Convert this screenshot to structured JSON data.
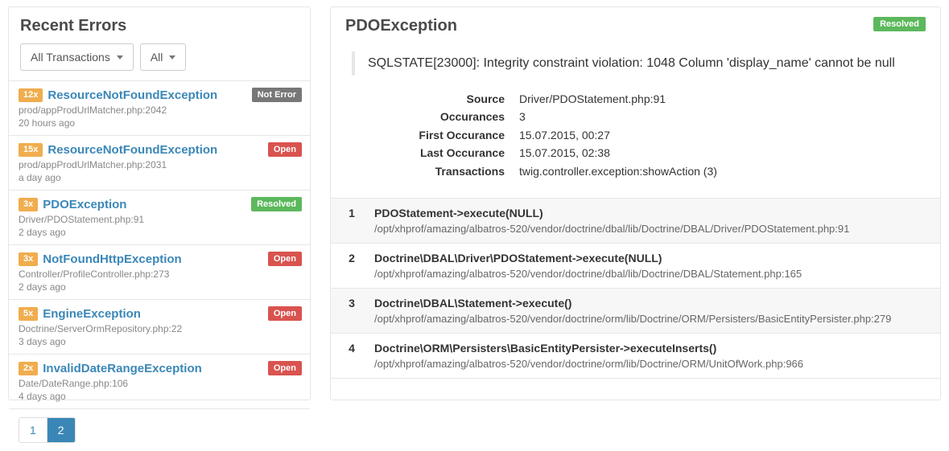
{
  "sidebar": {
    "title": "Recent Errors",
    "filters": {
      "transactions_label": "All Transactions",
      "types_label": "All"
    },
    "items": [
      {
        "count": "12x",
        "name": "ResourceNotFoundException",
        "file": "prod/appProdUrlMatcher.php:2042",
        "time": "20 hours ago",
        "status": "Not Error",
        "status_class": "status-noterror"
      },
      {
        "count": "15x",
        "name": "ResourceNotFoundException",
        "file": "prod/appProdUrlMatcher.php:2031",
        "time": "a day ago",
        "status": "Open",
        "status_class": "status-open"
      },
      {
        "count": "3x",
        "name": "PDOException",
        "file": "Driver/PDOStatement.php:91",
        "time": "2 days ago",
        "status": "Resolved",
        "status_class": "status-resolved"
      },
      {
        "count": "3x",
        "name": "NotFoundHttpException",
        "file": "Controller/ProfileController.php:273",
        "time": "2 days ago",
        "status": "Open",
        "status_class": "status-open"
      },
      {
        "count": "5x",
        "name": "EngineException",
        "file": "Doctrine/ServerOrmRepository.php:22",
        "time": "3 days ago",
        "status": "Open",
        "status_class": "status-open"
      },
      {
        "count": "2x",
        "name": "InvalidDateRangeException",
        "file": "Date/DateRange.php:106",
        "time": "4 days ago",
        "status": "Open",
        "status_class": "status-open"
      }
    ],
    "pagination": {
      "page1": "1",
      "page2": "2"
    }
  },
  "detail": {
    "title": "PDOException",
    "status": "Resolved",
    "message": "SQLSTATE[23000]: Integrity constraint violation: 1048 Column 'display_name' cannot be null",
    "meta": {
      "source_label": "Source",
      "source_value": "Driver/PDOStatement.php:91",
      "occurances_label": "Occurances",
      "occurances_value": "3",
      "first_label": "First Occurance",
      "first_value": "15.07.2015, 00:27",
      "last_label": "Last Occurance",
      "last_value": "15.07.2015, 02:38",
      "transactions_label": "Transactions",
      "transactions_value": "twig.controller.exception:showAction (3)"
    },
    "trace": [
      {
        "n": "1",
        "call": "PDOStatement->execute(NULL)",
        "path": "/opt/xhprof/amazing/albatros-520/vendor/doctrine/dbal/lib/Doctrine/DBAL/Driver/PDOStatement.php:91"
      },
      {
        "n": "2",
        "call": "Doctrine\\DBAL\\Driver\\PDOStatement->execute(NULL)",
        "path": "/opt/xhprof/amazing/albatros-520/vendor/doctrine/dbal/lib/Doctrine/DBAL/Statement.php:165"
      },
      {
        "n": "3",
        "call": "Doctrine\\DBAL\\Statement->execute()",
        "path": "/opt/xhprof/amazing/albatros-520/vendor/doctrine/orm/lib/Doctrine/ORM/Persisters/BasicEntityPersister.php:279"
      },
      {
        "n": "4",
        "call": "Doctrine\\ORM\\Persisters\\BasicEntityPersister->executeInserts()",
        "path": "/opt/xhprof/amazing/albatros-520/vendor/doctrine/orm/lib/Doctrine/ORM/UnitOfWork.php:966"
      }
    ]
  }
}
